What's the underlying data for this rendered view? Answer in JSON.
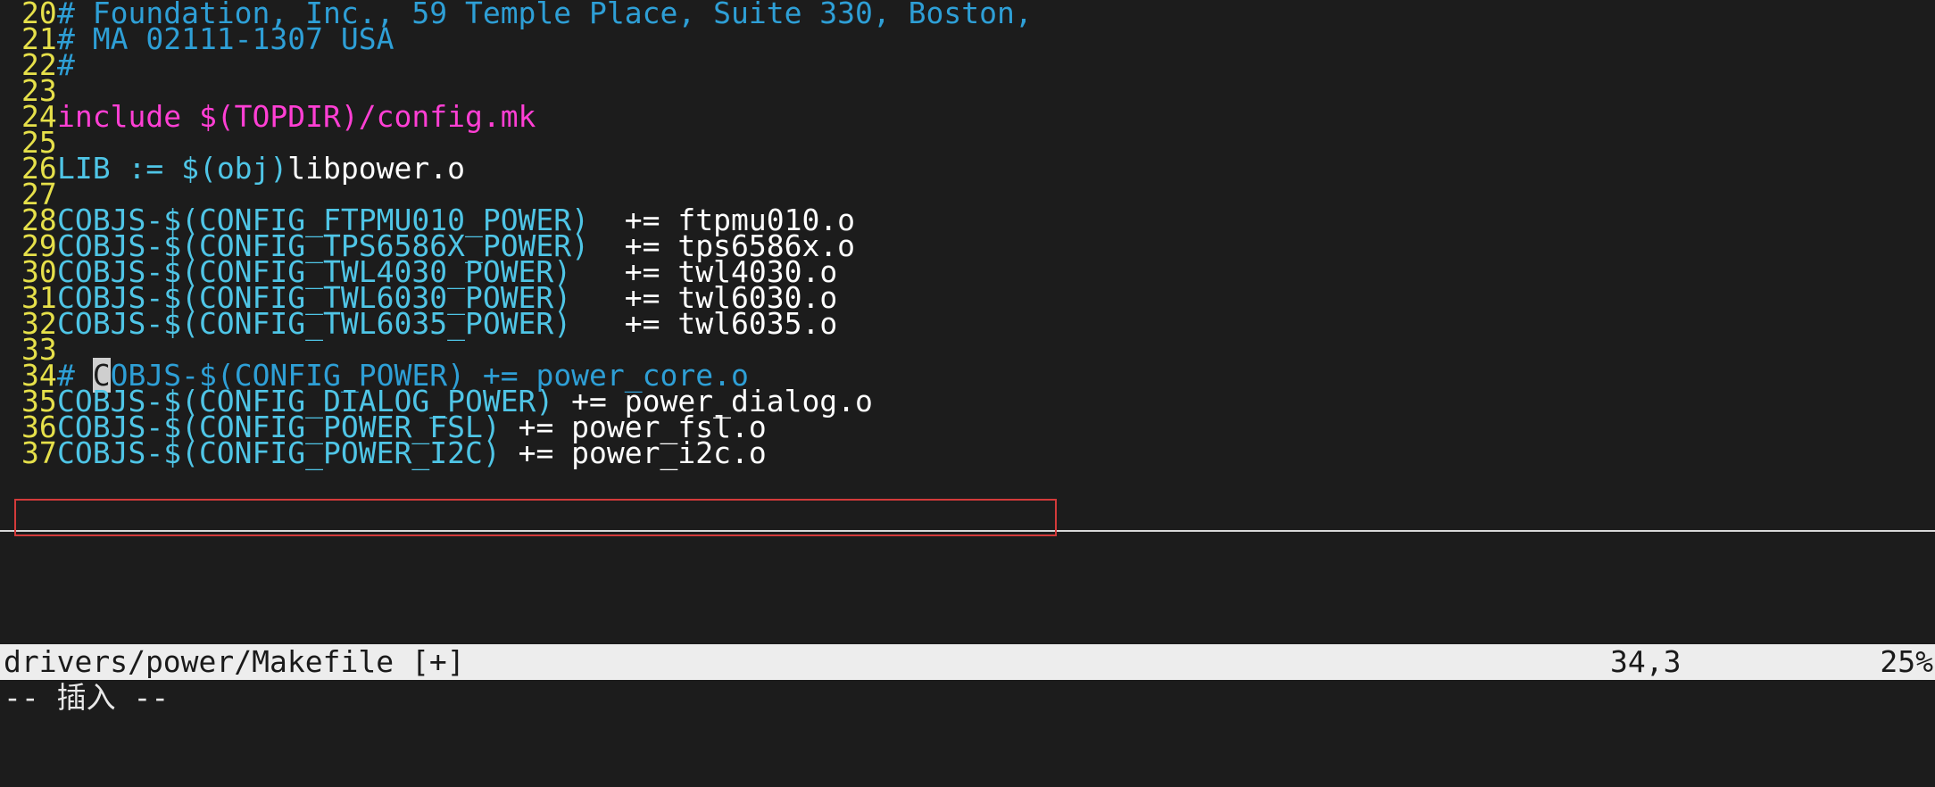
{
  "lines": [
    {
      "num": "20",
      "parts": [
        {
          "t": "# Foundation, Inc., 59 Temple Place, Suite 330, Boston,",
          "c": "cm"
        }
      ]
    },
    {
      "num": "21",
      "parts": [
        {
          "t": "# MA 02111-1307 USA",
          "c": "cm"
        }
      ]
    },
    {
      "num": "22",
      "parts": [
        {
          "t": "#",
          "c": "cm"
        }
      ]
    },
    {
      "num": "23",
      "parts": []
    },
    {
      "num": "24",
      "parts": [
        {
          "t": "include $(TOPDIR)/config.mk",
          "c": "pp"
        }
      ]
    },
    {
      "num": "25",
      "parts": []
    },
    {
      "num": "26",
      "parts": [
        {
          "t": "LIB := ",
          "c": "id"
        },
        {
          "t": "$(obj)",
          "c": "id"
        },
        {
          "t": "libpower.o",
          "c": "pl"
        }
      ]
    },
    {
      "num": "27",
      "parts": []
    },
    {
      "num": "28",
      "parts": [
        {
          "t": "COBJS-$(CONFIG_FTPMU010_POWER)",
          "c": "id"
        },
        {
          "t": "  += ftpmu010.o",
          "c": "pl"
        }
      ]
    },
    {
      "num": "29",
      "parts": [
        {
          "t": "COBJS-$(CONFIG_TPS6586X_POWER)",
          "c": "id"
        },
        {
          "t": "  += tps6586x.o",
          "c": "pl"
        }
      ]
    },
    {
      "num": "30",
      "parts": [
        {
          "t": "COBJS-$(CONFIG_TWL4030_POWER)",
          "c": "id"
        },
        {
          "t": "   += twl4030.o",
          "c": "pl"
        }
      ]
    },
    {
      "num": "31",
      "parts": [
        {
          "t": "COBJS-$(CONFIG_TWL6030_POWER)",
          "c": "id"
        },
        {
          "t": "   += twl6030.o",
          "c": "pl"
        }
      ]
    },
    {
      "num": "32",
      "parts": [
        {
          "t": "COBJS-$(CONFIG_TWL6035_POWER)",
          "c": "id"
        },
        {
          "t": "   += twl6035.o",
          "c": "pl"
        }
      ]
    },
    {
      "num": "33",
      "parts": []
    },
    {
      "num": "34",
      "parts": [
        {
          "t": "# ",
          "c": "cm"
        },
        {
          "t": "C",
          "c": "cursor"
        },
        {
          "t": "OBJS-$(CONFIG_POWER) += power_core.o",
          "c": "cm"
        }
      ]
    },
    {
      "num": "35",
      "parts": [
        {
          "t": "COBJS-$(CONFIG_DIALOG_POWER)",
          "c": "id"
        },
        {
          "t": " += power_dialog.o",
          "c": "pl"
        }
      ]
    },
    {
      "num": "36",
      "parts": [
        {
          "t": "COBJS-$(CONFIG_POWER_FSL)",
          "c": "id"
        },
        {
          "t": " += power_fsl.o",
          "c": "pl"
        }
      ]
    },
    {
      "num": "37",
      "parts": [
        {
          "t": "COBJS-$(CONFIG_POWER_I2C)",
          "c": "id"
        },
        {
          "t": " += power_i2c.o",
          "c": "pl"
        }
      ]
    }
  ],
  "status": {
    "file": "drivers/power/Makefile [+]",
    "position": "34,3",
    "percent": "25%"
  },
  "cmdline": "-- 插入 --"
}
